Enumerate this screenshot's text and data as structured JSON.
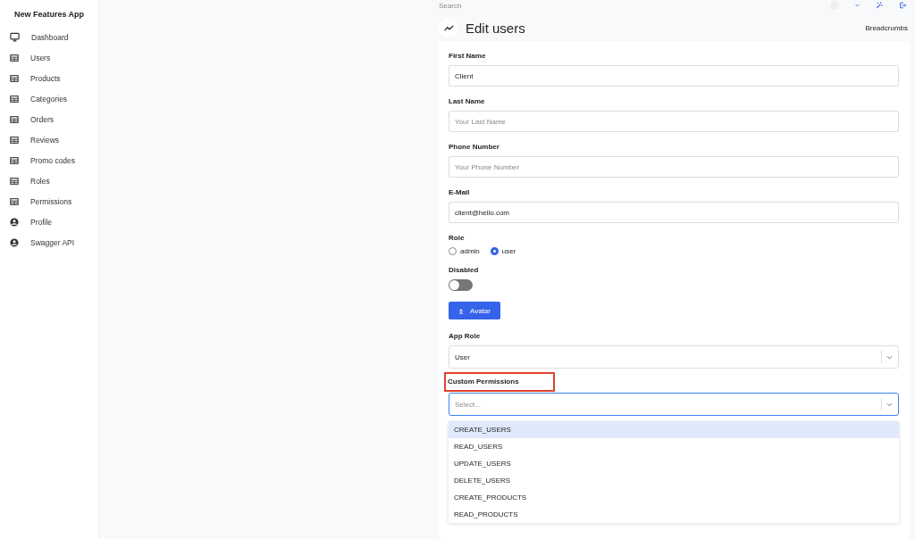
{
  "sidebar": {
    "title": "New Features App",
    "items": [
      {
        "label": "Dashboard",
        "kind": "dashboard"
      },
      {
        "label": "Users",
        "kind": "resource"
      },
      {
        "label": "Products",
        "kind": "resource"
      },
      {
        "label": "Categories",
        "kind": "resource"
      },
      {
        "label": "Orders",
        "kind": "resource"
      },
      {
        "label": "Reviews",
        "kind": "resource"
      },
      {
        "label": "Promo codes",
        "kind": "resource"
      },
      {
        "label": "Roles",
        "kind": "resource"
      },
      {
        "label": "Permissions",
        "kind": "resource"
      },
      {
        "label": "Profile",
        "kind": "account"
      },
      {
        "label": "Swagger API",
        "kind": "account"
      }
    ]
  },
  "topbar": {
    "search_placeholder": "Search"
  },
  "page": {
    "title": "Edit users",
    "breadcrumbs": "Breadcrumbs"
  },
  "form": {
    "fields": [
      {
        "kind": "text",
        "label": "First Name",
        "value": "Client"
      },
      {
        "kind": "text",
        "label": "Last Name",
        "placeholder": "Your Last Name"
      },
      {
        "kind": "text",
        "label": "Phone Number",
        "placeholder": "Your Phone Number"
      },
      {
        "kind": "text",
        "label": "E-Mail",
        "value": "client@hello.com"
      },
      {
        "kind": "radio",
        "label": "Role",
        "options": [
          {
            "label": "admin",
            "selected": false
          },
          {
            "label": "user",
            "selected": true
          }
        ]
      },
      {
        "kind": "toggle",
        "label": "Disabled",
        "on": false
      },
      {
        "kind": "upload",
        "button": "Avatar"
      },
      {
        "kind": "select",
        "label": "App Role",
        "value": "User",
        "focused": false
      },
      {
        "kind": "select",
        "label": "Custom Permissions",
        "highlighted": true,
        "placeholder": "Select...",
        "focused": true,
        "open": true,
        "options": [
          {
            "label": "CREATE_USERS",
            "selected": true
          },
          {
            "label": "READ_USERS",
            "selected": false
          },
          {
            "label": "UPDATE_USERS",
            "selected": false
          },
          {
            "label": "DELETE_USERS",
            "selected": false
          },
          {
            "label": "CREATE_PRODUCTS",
            "selected": false
          },
          {
            "label": "READ_PRODUCTS",
            "selected": false
          }
        ]
      }
    ]
  }
}
